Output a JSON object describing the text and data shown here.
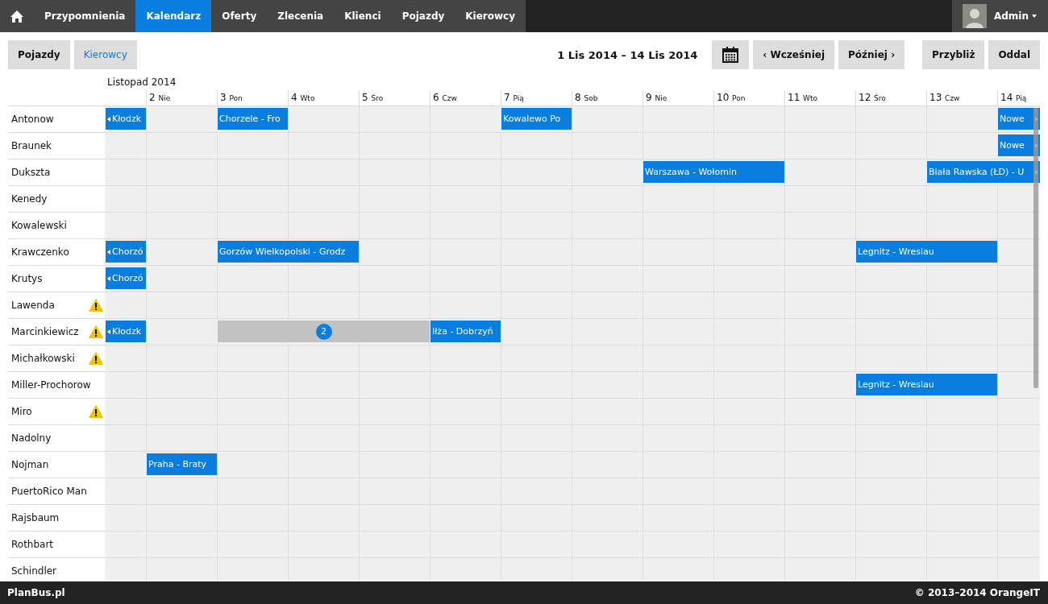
{
  "nav": {
    "items": [
      {
        "label": "Przypomnienia",
        "selected": false
      },
      {
        "label": "Kalendarz",
        "selected": true
      },
      {
        "label": "Oferty",
        "selected": false
      },
      {
        "label": "Zlecenia",
        "selected": false
      },
      {
        "label": "Klienci",
        "selected": false
      },
      {
        "label": "Pojazdy",
        "selected": false
      },
      {
        "label": "Kierowcy",
        "selected": false
      }
    ],
    "user": {
      "name": "Admin"
    }
  },
  "toolbar": {
    "view_tabs": [
      {
        "label": "Pojazdy",
        "selected": false
      },
      {
        "label": "Kierowcy",
        "selected": true
      }
    ],
    "date_range": "1 Lis 2014 – 14 Lis 2014",
    "nav_buttons": [
      "‹ Wcześniej",
      "Później ›"
    ],
    "zoom_buttons": [
      "Przybliż",
      "Oddal"
    ]
  },
  "calendar": {
    "month": "Listopad 2014",
    "days": [
      {
        "number": "2",
        "weekday": "Nie"
      },
      {
        "number": "3",
        "weekday": "Pon"
      },
      {
        "number": "4",
        "weekday": "Wto"
      },
      {
        "number": "5",
        "weekday": "Śro"
      },
      {
        "number": "6",
        "weekday": "Czw"
      },
      {
        "number": "7",
        "weekday": "Pią"
      },
      {
        "number": "8",
        "weekday": "Sob"
      },
      {
        "number": "9",
        "weekday": "Nie"
      },
      {
        "number": "10",
        "weekday": "Pon"
      },
      {
        "number": "11",
        "weekday": "Wto"
      },
      {
        "number": "12",
        "weekday": "Śro"
      },
      {
        "number": "13",
        "weekday": "Czw"
      },
      {
        "number": "14",
        "weekday": "Pią"
      }
    ],
    "drivers": [
      {
        "name": "Antonow",
        "warning": false,
        "cells": [
          {
            "kind": "trip",
            "title": "Kłodzk",
            "continues_before": true,
            "continues_after": false
          },
          {
            "kind": "empty"
          },
          {
            "kind": "trip",
            "title": "Chorzele - Fro",
            "continues_before": false,
            "continues_after": false
          },
          {
            "kind": "empty"
          },
          {
            "kind": "empty"
          },
          {
            "kind": "empty"
          },
          {
            "kind": "trip",
            "title": "Kowalewo Po",
            "continues_before": false,
            "continues_after": false
          },
          {
            "kind": "empty"
          },
          {
            "kind": "empty"
          },
          {
            "kind": "empty"
          },
          {
            "kind": "empty"
          },
          {
            "kind": "empty"
          },
          {
            "kind": "empty"
          },
          {
            "kind": "trip",
            "title": "Nowe",
            "continues_before": false,
            "continues_after": true
          }
        ]
      },
      {
        "name": "Braunek",
        "warning": false,
        "cells": [
          {
            "kind": "empty"
          },
          {
            "kind": "empty"
          },
          {
            "kind": "empty"
          },
          {
            "kind": "empty"
          },
          {
            "kind": "empty"
          },
          {
            "kind": "empty"
          },
          {
            "kind": "empty"
          },
          {
            "kind": "empty"
          },
          {
            "kind": "empty"
          },
          {
            "kind": "empty"
          },
          {
            "kind": "empty"
          },
          {
            "kind": "empty"
          },
          {
            "kind": "empty"
          },
          {
            "kind": "trip",
            "title": "Nowe",
            "continues_before": false,
            "continues_after": true
          }
        ]
      },
      {
        "name": "Dukszta",
        "warning": false,
        "cells": [
          {
            "kind": "empty"
          },
          {
            "kind": "empty"
          },
          {
            "kind": "empty"
          },
          {
            "kind": "empty"
          },
          {
            "kind": "empty"
          },
          {
            "kind": "empty"
          },
          {
            "kind": "empty"
          },
          {
            "kind": "empty"
          },
          {
            "kind": "trip",
            "title": "Warszawa - Wołomin",
            "continues_before": false,
            "continues_after": false
          },
          {
            "kind": "continued"
          },
          {
            "kind": "empty"
          },
          {
            "kind": "empty"
          },
          {
            "kind": "trip",
            "title": "Biała Rawska (ŁD) - U",
            "continues_before": false,
            "continues_after": true
          },
          {
            "kind": "continued"
          }
        ]
      },
      {
        "name": "Kenedy",
        "warning": false,
        "cells": [
          {
            "kind": "empty"
          },
          {
            "kind": "empty"
          },
          {
            "kind": "empty"
          },
          {
            "kind": "empty"
          },
          {
            "kind": "empty"
          },
          {
            "kind": "empty"
          },
          {
            "kind": "empty"
          },
          {
            "kind": "empty"
          },
          {
            "kind": "empty"
          },
          {
            "kind": "empty"
          },
          {
            "kind": "empty"
          },
          {
            "kind": "empty"
          },
          {
            "kind": "empty"
          },
          {
            "kind": "empty"
          }
        ]
      },
      {
        "name": "Kowalewski",
        "warning": false,
        "cells": [
          {
            "kind": "empty"
          },
          {
            "kind": "empty"
          },
          {
            "kind": "empty"
          },
          {
            "kind": "empty"
          },
          {
            "kind": "empty"
          },
          {
            "kind": "empty"
          },
          {
            "kind": "empty"
          },
          {
            "kind": "empty"
          },
          {
            "kind": "empty"
          },
          {
            "kind": "empty"
          },
          {
            "kind": "empty"
          },
          {
            "kind": "empty"
          },
          {
            "kind": "empty"
          },
          {
            "kind": "empty"
          }
        ]
      },
      {
        "name": "Krawczenko",
        "warning": false,
        "cells": [
          {
            "kind": "trip",
            "title": "Chorzó",
            "continues_before": true,
            "continues_after": false
          },
          {
            "kind": "empty"
          },
          {
            "kind": "trip",
            "title": "Gorzów Wielkopolski - Grodz",
            "continues_before": false,
            "continues_after": false
          },
          {
            "kind": "continued"
          },
          {
            "kind": "empty"
          },
          {
            "kind": "empty"
          },
          {
            "kind": "empty"
          },
          {
            "kind": "empty"
          },
          {
            "kind": "empty"
          },
          {
            "kind": "empty"
          },
          {
            "kind": "empty"
          },
          {
            "kind": "trip",
            "title": "Legnitz - Wreslau",
            "continues_before": false,
            "continues_after": false
          },
          {
            "kind": "continued"
          },
          {
            "kind": "empty"
          }
        ]
      },
      {
        "name": "Krutys",
        "warning": false,
        "cells": [
          {
            "kind": "trip",
            "title": "Chorzó",
            "continues_before": true,
            "continues_after": false
          },
          {
            "kind": "empty"
          },
          {
            "kind": "empty"
          },
          {
            "kind": "empty"
          },
          {
            "kind": "empty"
          },
          {
            "kind": "empty"
          },
          {
            "kind": "empty"
          },
          {
            "kind": "empty"
          },
          {
            "kind": "empty"
          },
          {
            "kind": "empty"
          },
          {
            "kind": "empty"
          },
          {
            "kind": "empty"
          },
          {
            "kind": "empty"
          },
          {
            "kind": "empty"
          }
        ]
      },
      {
        "name": "Lawenda",
        "warning": true,
        "cells": [
          {
            "kind": "empty"
          },
          {
            "kind": "empty"
          },
          {
            "kind": "empty"
          },
          {
            "kind": "empty"
          },
          {
            "kind": "empty"
          },
          {
            "kind": "empty"
          },
          {
            "kind": "empty"
          },
          {
            "kind": "empty"
          },
          {
            "kind": "empty"
          },
          {
            "kind": "empty"
          },
          {
            "kind": "empty"
          },
          {
            "kind": "empty"
          },
          {
            "kind": "empty"
          },
          {
            "kind": "empty"
          }
        ]
      },
      {
        "name": "Marcinkiewicz",
        "warning": true,
        "cells": [
          {
            "kind": "trip",
            "title": "Kłodzk",
            "continues_before": true,
            "continues_after": false
          },
          {
            "kind": "empty"
          },
          {
            "kind": "group",
            "count": "2"
          },
          {
            "kind": "continued"
          },
          {
            "kind": "continued"
          },
          {
            "kind": "trip",
            "title": "Iłża - Dobrzyń",
            "continues_before": false,
            "continues_after": false
          },
          {
            "kind": "empty"
          },
          {
            "kind": "empty"
          },
          {
            "kind": "empty"
          },
          {
            "kind": "empty"
          },
          {
            "kind": "empty"
          },
          {
            "kind": "empty"
          },
          {
            "kind": "empty"
          },
          {
            "kind": "empty"
          }
        ]
      },
      {
        "name": "Michałkowski",
        "warning": true,
        "cells": [
          {
            "kind": "empty"
          },
          {
            "kind": "empty"
          },
          {
            "kind": "empty"
          },
          {
            "kind": "empty"
          },
          {
            "kind": "empty"
          },
          {
            "kind": "empty"
          },
          {
            "kind": "empty"
          },
          {
            "kind": "empty"
          },
          {
            "kind": "empty"
          },
          {
            "kind": "empty"
          },
          {
            "kind": "empty"
          },
          {
            "kind": "empty"
          },
          {
            "kind": "empty"
          },
          {
            "kind": "empty"
          }
        ]
      },
      {
        "name": "Miller-Prochorow",
        "warning": false,
        "cells": [
          {
            "kind": "empty"
          },
          {
            "kind": "empty"
          },
          {
            "kind": "empty"
          },
          {
            "kind": "empty"
          },
          {
            "kind": "empty"
          },
          {
            "kind": "empty"
          },
          {
            "kind": "empty"
          },
          {
            "kind": "empty"
          },
          {
            "kind": "empty"
          },
          {
            "kind": "empty"
          },
          {
            "kind": "empty"
          },
          {
            "kind": "trip",
            "title": "Legnitz - Wreslau",
            "continues_before": false,
            "continues_after": false
          },
          {
            "kind": "continued"
          },
          {
            "kind": "empty"
          }
        ]
      },
      {
        "name": "Miro",
        "warning": true,
        "cells": [
          {
            "kind": "empty"
          },
          {
            "kind": "empty"
          },
          {
            "kind": "empty"
          },
          {
            "kind": "empty"
          },
          {
            "kind": "empty"
          },
          {
            "kind": "empty"
          },
          {
            "kind": "empty"
          },
          {
            "kind": "empty"
          },
          {
            "kind": "empty"
          },
          {
            "kind": "empty"
          },
          {
            "kind": "empty"
          },
          {
            "kind": "empty"
          },
          {
            "kind": "empty"
          },
          {
            "kind": "empty"
          }
        ]
      },
      {
        "name": "Nadolny",
        "warning": false,
        "cells": [
          {
            "kind": "empty"
          },
          {
            "kind": "empty"
          },
          {
            "kind": "empty"
          },
          {
            "kind": "empty"
          },
          {
            "kind": "empty"
          },
          {
            "kind": "empty"
          },
          {
            "kind": "empty"
          },
          {
            "kind": "empty"
          },
          {
            "kind": "empty"
          },
          {
            "kind": "empty"
          },
          {
            "kind": "empty"
          },
          {
            "kind": "empty"
          },
          {
            "kind": "empty"
          },
          {
            "kind": "empty"
          }
        ]
      },
      {
        "name": "Nojman",
        "warning": false,
        "cells": [
          {
            "kind": "empty"
          },
          {
            "kind": "trip",
            "title": "Praha - Braty",
            "continues_before": false,
            "continues_after": false
          },
          {
            "kind": "empty"
          },
          {
            "kind": "empty"
          },
          {
            "kind": "empty"
          },
          {
            "kind": "empty"
          },
          {
            "kind": "empty"
          },
          {
            "kind": "empty"
          },
          {
            "kind": "empty"
          },
          {
            "kind": "empty"
          },
          {
            "kind": "empty"
          },
          {
            "kind": "empty"
          },
          {
            "kind": "empty"
          },
          {
            "kind": "empty"
          }
        ]
      },
      {
        "name": "PuertoRico Man",
        "warning": false,
        "cells": [
          {
            "kind": "empty"
          },
          {
            "kind": "empty"
          },
          {
            "kind": "empty"
          },
          {
            "kind": "empty"
          },
          {
            "kind": "empty"
          },
          {
            "kind": "empty"
          },
          {
            "kind": "empty"
          },
          {
            "kind": "empty"
          },
          {
            "kind": "empty"
          },
          {
            "kind": "empty"
          },
          {
            "kind": "empty"
          },
          {
            "kind": "empty"
          },
          {
            "kind": "empty"
          },
          {
            "kind": "empty"
          }
        ]
      },
      {
        "name": "Rajsbaum",
        "warning": false,
        "cells": [
          {
            "kind": "empty"
          },
          {
            "kind": "empty"
          },
          {
            "kind": "empty"
          },
          {
            "kind": "empty"
          },
          {
            "kind": "empty"
          },
          {
            "kind": "empty"
          },
          {
            "kind": "empty"
          },
          {
            "kind": "empty"
          },
          {
            "kind": "empty"
          },
          {
            "kind": "empty"
          },
          {
            "kind": "empty"
          },
          {
            "kind": "empty"
          },
          {
            "kind": "empty"
          },
          {
            "kind": "empty"
          }
        ]
      },
      {
        "name": "Rothbart",
        "warning": false,
        "cells": [
          {
            "kind": "empty"
          },
          {
            "kind": "empty"
          },
          {
            "kind": "empty"
          },
          {
            "kind": "empty"
          },
          {
            "kind": "empty"
          },
          {
            "kind": "empty"
          },
          {
            "kind": "empty"
          },
          {
            "kind": "empty"
          },
          {
            "kind": "empty"
          },
          {
            "kind": "empty"
          },
          {
            "kind": "empty"
          },
          {
            "kind": "empty"
          },
          {
            "kind": "empty"
          },
          {
            "kind": "empty"
          }
        ]
      },
      {
        "name": "Schindler",
        "warning": false,
        "cells": [
          {
            "kind": "empty"
          },
          {
            "kind": "empty"
          },
          {
            "kind": "empty"
          },
          {
            "kind": "empty"
          },
          {
            "kind": "empty"
          },
          {
            "kind": "empty"
          },
          {
            "kind": "empty"
          },
          {
            "kind": "empty"
          },
          {
            "kind": "empty"
          },
          {
            "kind": "empty"
          },
          {
            "kind": "empty"
          },
          {
            "kind": "empty"
          },
          {
            "kind": "empty"
          },
          {
            "kind": "empty"
          }
        ]
      }
    ]
  },
  "footer": {
    "brand": "PlanBus.pl",
    "copyright": "© 2013–2014 OrangeIT"
  }
}
